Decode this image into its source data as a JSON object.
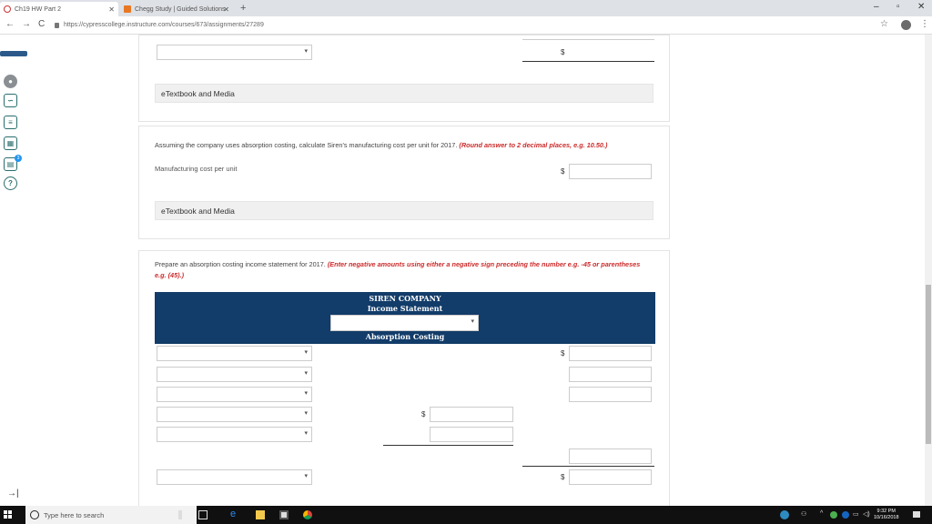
{
  "browser": {
    "tabs": [
      {
        "label": "Ch19 HW Part 2",
        "active": true
      },
      {
        "label": "Chegg Study | Guided Solutions",
        "active": false
      }
    ],
    "new_tab": "+",
    "url": "https://cypresscollege.instructure.com/courses/673/assignments/27289",
    "window_controls": [
      "–",
      "▫",
      "✕"
    ],
    "nav": [
      "←",
      "→",
      "C"
    ]
  },
  "sidebar": {
    "icons": [
      "user-avatar-icon",
      "handshake-icon",
      "book-icon",
      "calculator-icon",
      "gradebook-icon",
      "help-icon"
    ],
    "help_glyph": "?",
    "badge_count": "3",
    "collapse_glyph": "→|"
  },
  "section_top": {
    "dollar": "$",
    "etextbook": "eTextbook and Media"
  },
  "question_unit_cost": {
    "prompt": "Assuming the company uses absorption costing, calculate Siren's manufacturing cost per unit for 2017.",
    "instruction": "(Round answer to 2 decimal places, e.g. 10.50.)",
    "field_label": "Manufacturing cost per unit",
    "dollar": "$",
    "etextbook": "eTextbook and Media"
  },
  "question_income": {
    "prompt": "Prepare an absorption costing income statement for 2017.",
    "instruction": "(Enter negative amounts using either a negative sign preceding the number e.g. -45 or parentheses e.g. (45).)",
    "company": "SIREN COMPANY",
    "statement": "Income Statement",
    "method": "Absorption Costing",
    "dollar": "$"
  },
  "taskbar": {
    "search_placeholder": "Type here to search",
    "time": "9:32 PM",
    "date": "10/16/2018"
  }
}
